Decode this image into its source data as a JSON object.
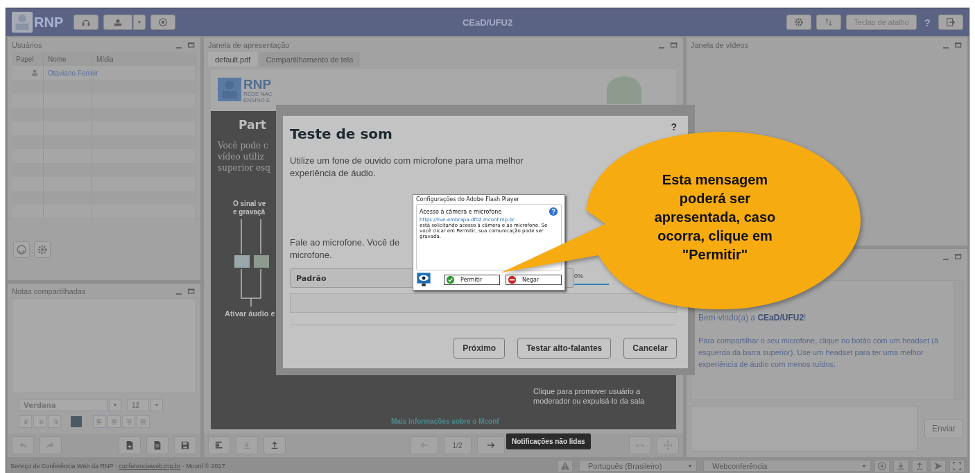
{
  "topbar": {
    "logo": "RNP",
    "title": "CEaD/UFU2",
    "shortcuts_button": "Teclas de atalho",
    "help_button": "?"
  },
  "users_panel": {
    "title": "Usuários",
    "columns": [
      "Papel",
      "Nome",
      "Mídia"
    ],
    "rows": [
      {
        "name": "Otaviano Ferreir"
      }
    ]
  },
  "notes_panel": {
    "title": "Notas compartilhadas",
    "font": "Verdana",
    "font_size": "12"
  },
  "presentation": {
    "title": "Janela de apresentação",
    "tabs": [
      {
        "label": "default.pdf",
        "selected": true
      },
      {
        "label": "Compartilhamento de tela",
        "selected": false
      }
    ],
    "slide": {
      "logo": "RNP",
      "logo_lines": [
        "REDE NAC",
        "ENSINO E"
      ],
      "heading": "Part",
      "paragraph_lines": [
        "Você pode c",
        "vídeo utiliz",
        "superior esq"
      ],
      "diagram_caption_lines": [
        "O sinal ve",
        "e gravaçã"
      ],
      "diagram_footer": "Ativar áudio e",
      "side_note": "Clique para promover usuário a moderador ou expulsá-lo da sala",
      "link": "Mais informações sobre o Mconf"
    },
    "page": "1/2"
  },
  "video_panel": {
    "title": "Janela de vídeos"
  },
  "chat": {
    "welcome": "Bem-vindo(a) a **CEaD/UFU2**!",
    "message": "Para compartilhar o seu microfone, clique no botão com um headset (à esquerda da barra superior). Use um headset para ter uma melhor experiência de áudio com menos ruídos.",
    "send_button": "Enviar"
  },
  "status_bar": {
    "text_before": "Serviço de Conferência Web da RNP · ",
    "link": "conferenciaweb.rnp.br",
    "text_after": " · Mconf © 2017",
    "language": "Português (Brasileiro)",
    "layout": "Webconferência"
  },
  "tooltip": "Notificações não lidas",
  "dialog": {
    "title": "Teste de som",
    "help": "?",
    "intro": "Utilize um fone de ouvido com microfone para uma melhor experiência de áudio.",
    "instruction_lines": [
      "Fale ao microfone. Você de",
      "microfone."
    ],
    "device": "Padrão",
    "meter_label": "0%",
    "buttons": [
      "Próximo",
      "Testar alto-falantes",
      "Cancelar"
    ]
  },
  "flash_dialog": {
    "title": "Configurações do Adobe Flash Player",
    "heading": "Acesso à câmera e microfone",
    "url": "https://live-embrapa-df02.mconf.rnp.br",
    "message": "está solicitando acesso à câmera e ao microfone. Se você clicar em Permitir, sua comunicação pode ser gravada.",
    "allow_button": "Permitir",
    "deny_button": "Negar"
  },
  "callout": {
    "text": "Esta mensagem poderá ser apresentada, caso ocorra, clique em \"Permitir\""
  }
}
